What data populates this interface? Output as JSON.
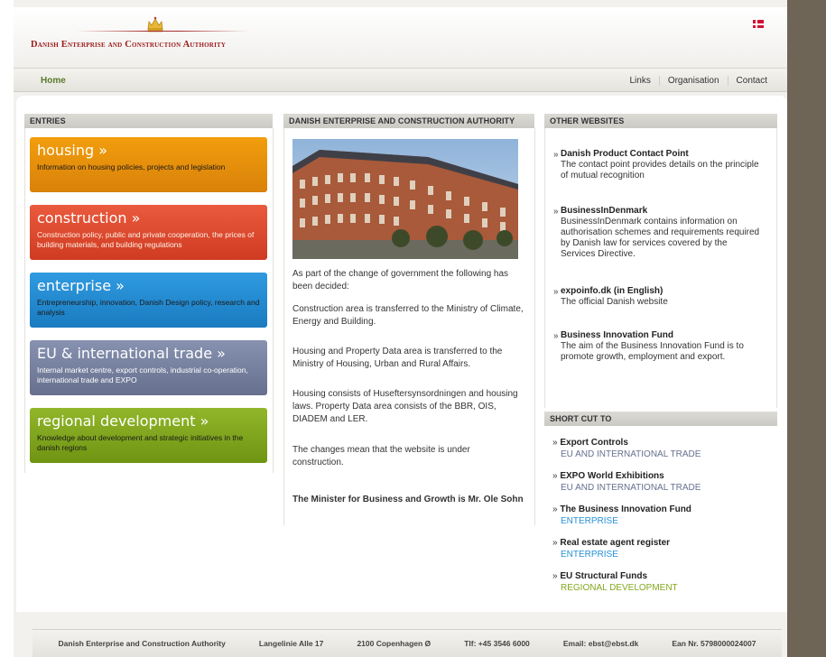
{
  "header": {
    "logo": "Danish Enterprise and Construction Authority",
    "flag": "danish-flag-icon"
  },
  "nav": {
    "home": "Home",
    "links": [
      "Links",
      "Organisation",
      "Contact"
    ]
  },
  "columns": {
    "entries": "ENTRIES",
    "middle": "DANISH ENTERPRISE AND CONSTRUCTION AUTHORITY",
    "other": "OTHER WEBSITES",
    "shortcut": "SHORT CUT TO"
  },
  "entries": [
    {
      "title": "housing »",
      "desc": "Information on housing policies, projects and legislation",
      "color": "#e8930b"
    },
    {
      "title": "construction »",
      "desc": "Construction policy, public and private cooperation, the prices of building materials, and building regulations",
      "color": "#de4a2f"
    },
    {
      "title": "enterprise »",
      "desc": "Entrepreneurship, innovation, Danish Design policy, research and analysis",
      "color": "#2690d6"
    },
    {
      "title": "EU & international trade »",
      "desc": "Internal market centre, export controls, industrial co-operation, international trade and EXPO",
      "color": "#7a84a3"
    },
    {
      "title": "regional development »",
      "desc": "Knowledge about development and strategic initiatives in the danish regions",
      "color": "#84a81f"
    }
  ],
  "middle": {
    "p1": "As part of the change of government the following has been decided:",
    "p2": "Construction area is transferred to the Ministry of Climate, Energy and Building.",
    "p3": "Housing and Property Data area is transferred to the Ministry of Housing, Urban and Rural Affairs.",
    "p4": "Housing consists of Huseftersynsordningen and housing laws. Property Data area consists of the BBR, OIS, DIADEM and LER.",
    "p5": "The changes mean that the website is under construction.",
    "p6": "The Minister for Business and Growth is Mr. Ole Sohn"
  },
  "other_websites": [
    {
      "title": "Danish Product Contact Point",
      "desc": "The contact point provides details on the principle of mutual recognition"
    },
    {
      "title": "BusinessInDenmark",
      "desc": "BusinessInDenmark contains information on authorisation schemes and requirements required by Danish law for services covered by the Services Directive."
    },
    {
      "title": "expoinfo.dk (in English)",
      "desc": "The official Danish website"
    },
    {
      "title": "Business Innovation Fund",
      "desc": "The aim of the Business Innovation Fund is to promote growth, employment and export."
    }
  ],
  "shortcuts": [
    {
      "title": "Export Controls",
      "category": "EU AND INTERNATIONAL TRADE",
      "color": "#66708e"
    },
    {
      "title": "EXPO World Exhibitions",
      "category": "EU AND INTERNATIONAL TRADE",
      "color": "#66708e"
    },
    {
      "title": "The Business Innovation Fund",
      "category": "ENTERPRISE",
      "color": "#2690d6"
    },
    {
      "title": "Real estate agent register",
      "category": "ENTERPRISE",
      "color": "#2690d6"
    },
    {
      "title": "EU Structural Funds",
      "category": "REGIONAL DEVELOPMENT",
      "color": "#84a81f"
    }
  ],
  "footer": {
    "name": "Danish Enterprise and Construction Authority",
    "address": "Langelinie Alle 17",
    "city": "2100 Copenhagen Ø",
    "phone": "Tlf: +45 3546 6000",
    "email": "Email: ebst@ebst.dk",
    "ean": "Ean Nr. 5798000024007"
  }
}
